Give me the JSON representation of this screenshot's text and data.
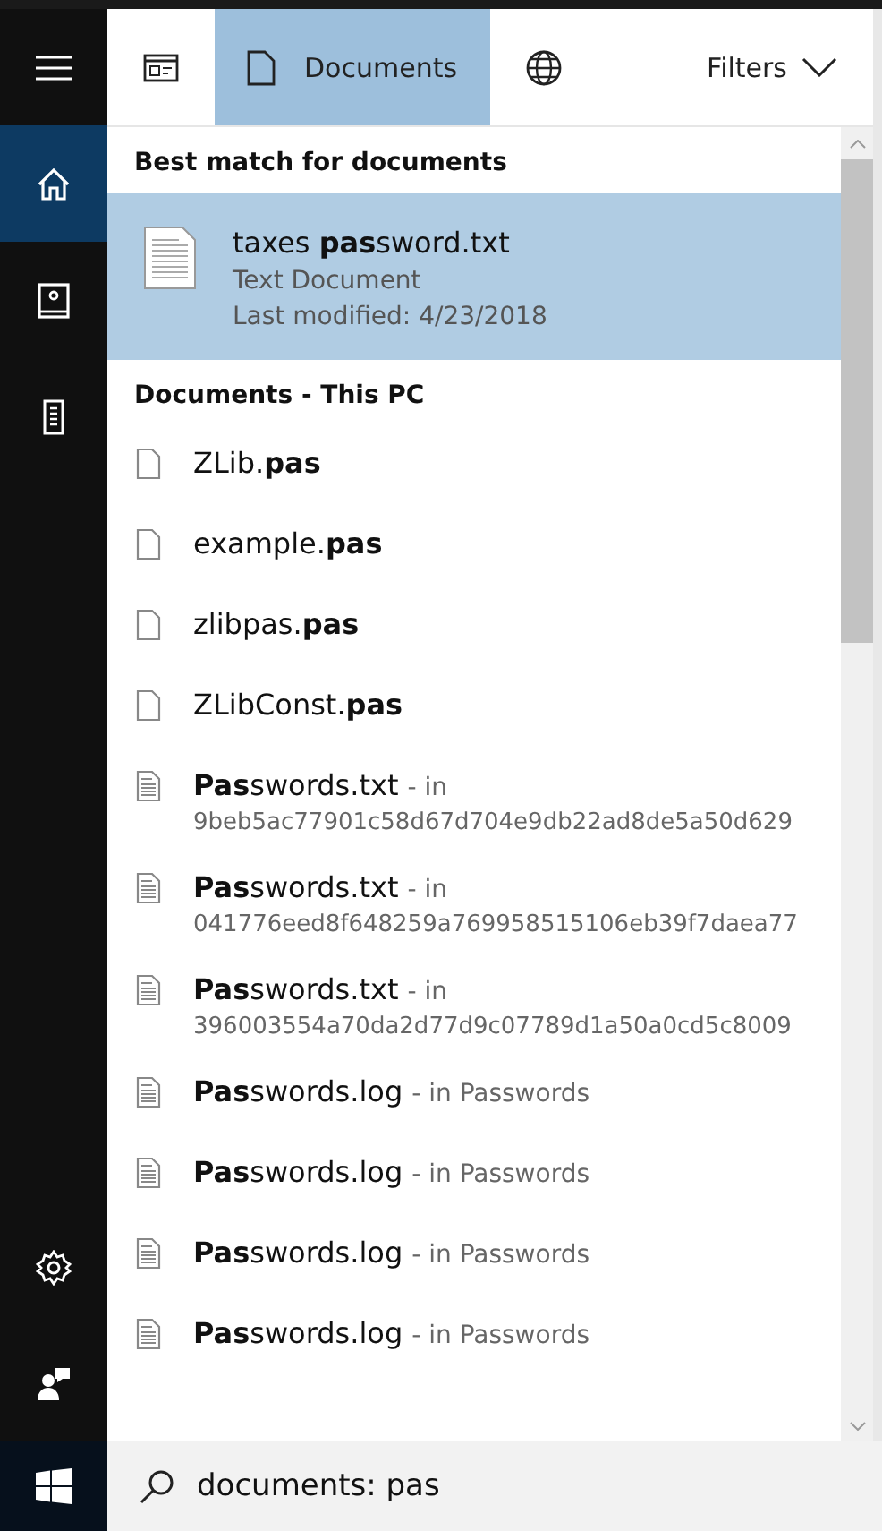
{
  "sidebar": {
    "top_items": [
      {
        "kind": "menu",
        "selected": false
      },
      {
        "kind": "home",
        "selected": true
      },
      {
        "kind": "notebook",
        "selected": false
      },
      {
        "kind": "device",
        "selected": false
      }
    ],
    "bottom_items": [
      {
        "kind": "settings",
        "selected": false
      },
      {
        "kind": "feedback",
        "selected": false
      }
    ]
  },
  "tabs": [
    {
      "kind": "apps",
      "selected": false
    },
    {
      "kind": "documents",
      "label": "Documents",
      "selected": true
    },
    {
      "kind": "web",
      "selected": false
    }
  ],
  "filters": {
    "label": "Filters"
  },
  "best_match": {
    "heading": "Best match for documents",
    "title": "taxes **pas**sword.txt",
    "type": "Text Document",
    "modified": "Last modified: 4/23/2018",
    "selected": true
  },
  "documents": {
    "heading": "Documents - This PC",
    "items": [
      {
        "kind": "plain",
        "name": "ZLib.**pas**"
      },
      {
        "kind": "plain",
        "name": "example.**pas**"
      },
      {
        "kind": "plain",
        "name": "zlibpas.**pas**"
      },
      {
        "kind": "plain",
        "name": "ZLibConst.**pas**"
      },
      {
        "kind": "text",
        "name": "**Pas**swords.txt",
        "location": "- in",
        "path": "9beb5ac77901c58d67d704e9db22ad8de5a50d629"
      },
      {
        "kind": "text",
        "name": "**Pas**swords.txt",
        "location": "- in",
        "path": "041776eed8f648259a769958515106eb39f7daea77"
      },
      {
        "kind": "text",
        "name": "**Pas**swords.txt",
        "location": "- in",
        "path": "396003554a70da2d77d9c07789d1a50a0cd5c8009"
      },
      {
        "kind": "text",
        "name": "**Pas**swords.log",
        "location": "- in Passwords"
      },
      {
        "kind": "text",
        "name": "**Pas**swords.log",
        "location": "- in Passwords"
      },
      {
        "kind": "text",
        "name": "**Pas**swords.log",
        "location": "- in Passwords"
      },
      {
        "kind": "text",
        "name": "**Pas**swords.log",
        "location": "- in Passwords"
      }
    ]
  },
  "search": {
    "value": "documents: pas"
  }
}
